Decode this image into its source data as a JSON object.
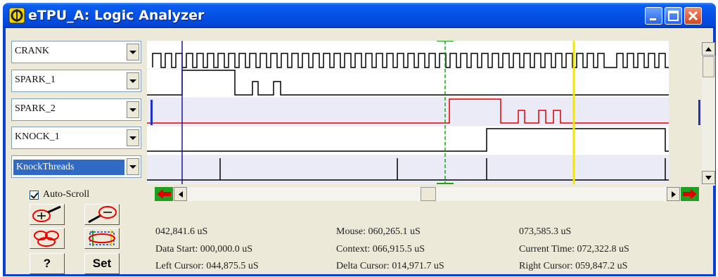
{
  "window": {
    "title": "eTPU_A: Logic Analyzer"
  },
  "channels": [
    {
      "label": "CRANK"
    },
    {
      "label": "SPARK_1"
    },
    {
      "label": "SPARK_2"
    },
    {
      "label": "KNOCK_1"
    },
    {
      "label": "KnockThreads"
    }
  ],
  "controls": {
    "auto_scroll_label": "Auto-Scroll",
    "auto_scroll_checked": true,
    "help_label": "?",
    "set_label": "Set"
  },
  "colors": {
    "spark2_trace": "#e00000",
    "left_cursor": "#1a1a8c",
    "context_marker": "#20a020",
    "right_cursor": "#f5e600"
  },
  "status": {
    "view_start": "042,841.6 uS",
    "view_end": "073,585.3 uS",
    "data_start": "Data Start:  000,000.0 uS",
    "left_cursor": "Left Cursor: 044,875.5 uS",
    "mouse": "Mouse: 060,265.1 uS",
    "context": "Context: 066,915.5 uS",
    "delta_cursor": "Delta Cursor:  014,971.7 uS",
    "current_time": "Current Time:  072,322.8 uS",
    "right_cursor": "Right Cursor: 059,847.2 uS"
  }
}
